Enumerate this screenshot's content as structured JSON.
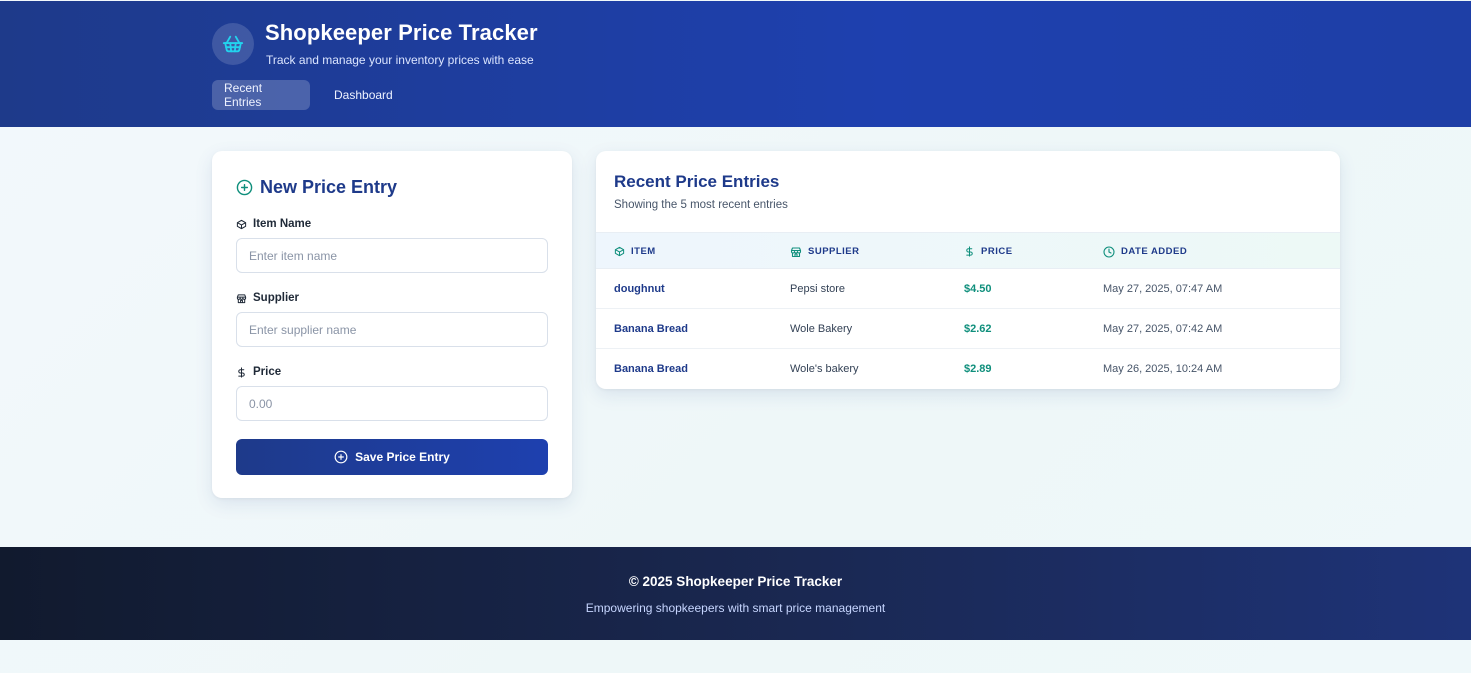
{
  "app": {
    "title": "Shopkeeper Price Tracker",
    "subtitle": "Track and manage your inventory prices with ease"
  },
  "nav": {
    "tabs": [
      {
        "label": "Recent Entries",
        "active": true
      },
      {
        "label": "Dashboard",
        "active": false
      }
    ]
  },
  "form": {
    "title": "New Price Entry",
    "item_label": "Item Name",
    "item_placeholder": "Enter item name",
    "supplier_label": "Supplier",
    "supplier_placeholder": "Enter supplier name",
    "price_label": "Price",
    "price_placeholder": "0.00",
    "save_label": "Save Price Entry"
  },
  "table": {
    "title": "Recent Price Entries",
    "subtitle": "Showing the 5 most recent entries",
    "columns": [
      "ITEM",
      "SUPPLIER",
      "PRICE",
      "DATE ADDED"
    ],
    "rows": [
      {
        "item": "doughnut",
        "supplier": "Pepsi store",
        "price": "$4.50",
        "date": "May 27, 2025, 07:47 AM"
      },
      {
        "item": "Banana Bread",
        "supplier": "Wole Bakery",
        "price": "$2.62",
        "date": "May 27, 2025, 07:42 AM"
      },
      {
        "item": "Banana Bread",
        "supplier": "Wole's bakery",
        "price": "$2.89",
        "date": "May 26, 2025, 10:24 AM"
      }
    ]
  },
  "footer": {
    "copyright": "© 2025 Shopkeeper Price Tracker",
    "tagline": "Empowering shopkeepers with smart price management"
  },
  "colors": {
    "brand_navy": "#1e3a8a",
    "accent_teal": "#0f8f7c",
    "icon_cyan": "#22d3ee"
  },
  "icons": {
    "brand": "shopping-basket-icon",
    "form_title": "plus-circle-icon",
    "item": "package-icon",
    "supplier": "store-icon",
    "price": "dollar-icon",
    "date": "clock-icon"
  }
}
